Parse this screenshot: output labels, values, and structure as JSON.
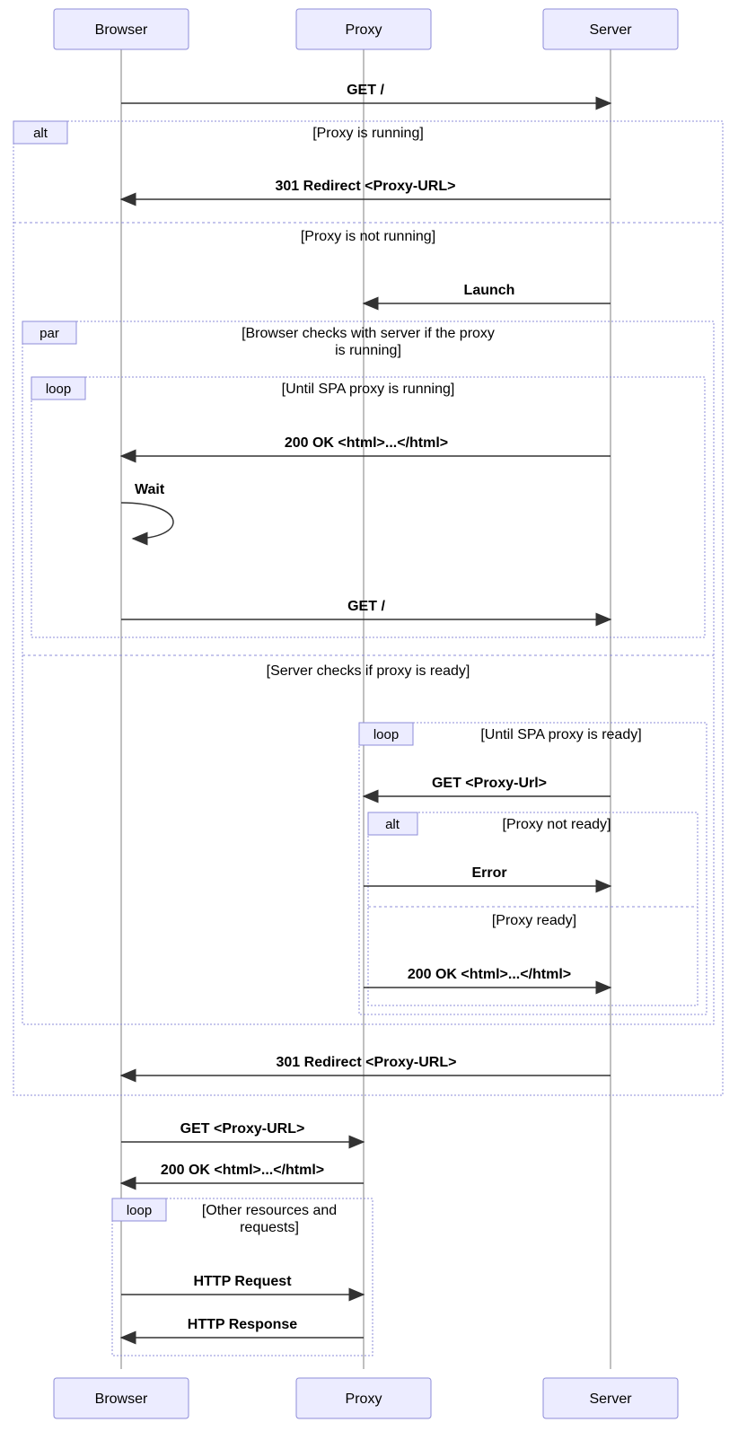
{
  "participants": {
    "browser": "Browser",
    "proxy": "Proxy",
    "server": "Server"
  },
  "fragments": {
    "alt": "alt",
    "par": "par",
    "loop": "loop"
  },
  "guards": {
    "proxy_running": "[Proxy is running]",
    "proxy_not_running": "[Proxy is not running]",
    "browser_checks": "[Browser checks with server if the proxy",
    "browser_checks_line2": "is running]",
    "until_proxy_running": "[Until SPA proxy is running]",
    "server_checks": "[Server checks if proxy is ready]",
    "until_proxy_ready": "[Until SPA proxy is ready]",
    "proxy_not_ready": "[Proxy not ready]",
    "proxy_ready": "[Proxy ready]",
    "other_resources": "[Other resources and",
    "other_resources_line2": "requests]"
  },
  "messages": {
    "get_root": "GET /",
    "redirect_301": "301 Redirect <Proxy-URL>",
    "launch": "Launch",
    "ok_html": "200 OK <html>...</html>",
    "wait": "Wait",
    "get_proxy_url": "GET <Proxy-Url>",
    "get_proxy_url2": "GET <Proxy-URL>",
    "error": "Error",
    "http_request": "HTTP Request",
    "http_response": "HTTP Response"
  }
}
